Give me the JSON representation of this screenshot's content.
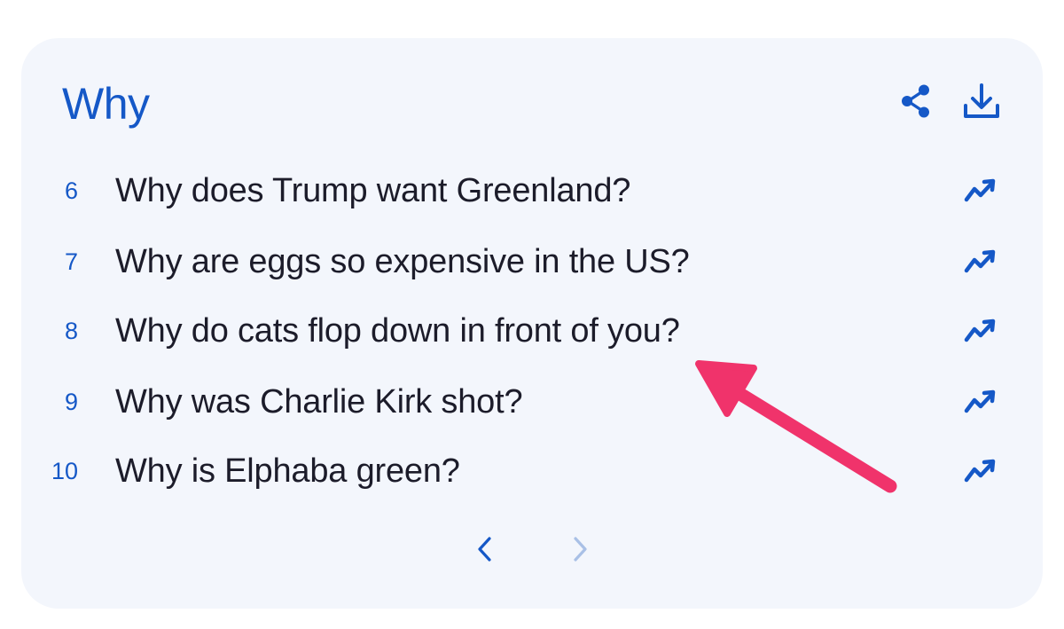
{
  "card": {
    "title": "Why",
    "actions": [
      {
        "icon": "share-icon"
      },
      {
        "icon": "download-icon"
      }
    ]
  },
  "rows": [
    {
      "rank": "6",
      "query": "Why does Trump want Greenland?",
      "icon": "trending-up-icon"
    },
    {
      "rank": "7",
      "query": "Why are eggs so expensive in the US?",
      "icon": "trending-up-icon"
    },
    {
      "rank": "8",
      "query": "Why do cats flop down in front of you?",
      "icon": "trending-up-icon"
    },
    {
      "rank": "9",
      "query": "Why was Charlie Kirk shot?",
      "icon": "trending-up-icon"
    },
    {
      "rank": "10",
      "query": "Why is Elphaba green?",
      "icon": "trending-up-icon"
    }
  ],
  "pagination": {
    "prev_icon": "chevron-left-icon",
    "next_icon": "chevron-right-icon",
    "prev_enabled": true,
    "next_enabled": false
  },
  "annotation": {
    "icon": "pointer-arrow-icon",
    "color": "#f0336b"
  },
  "colors": {
    "accent": "#1558c7",
    "card_background": "#f3f6fc",
    "text": "#1c1c2a",
    "disabled": "#a9c0e6"
  }
}
